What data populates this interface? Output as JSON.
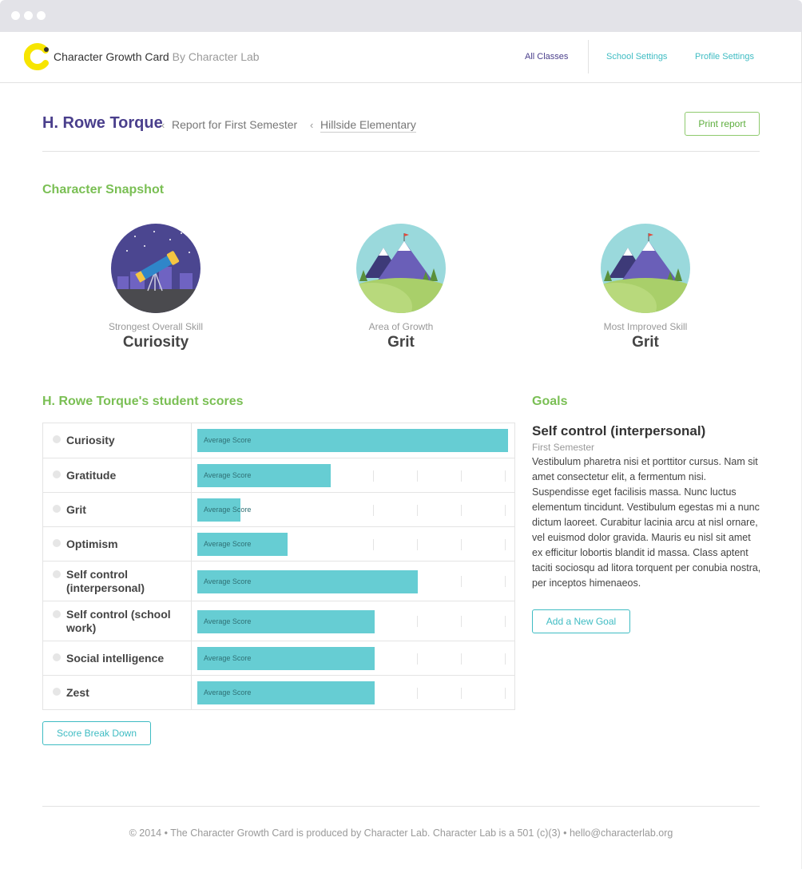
{
  "window": {
    "controls": [
      "dot",
      "dot",
      "dot"
    ]
  },
  "header": {
    "brand": "Character Growth Card",
    "brand_by": "By Character Lab",
    "nav": [
      {
        "label": "All Classes",
        "active": true
      },
      {
        "label": "School Settings",
        "active": false
      },
      {
        "label": "Profile Settings",
        "active": false
      }
    ]
  },
  "title": {
    "student": "H. Rowe Torque",
    "separator": "‹",
    "report": "Report for First Semester",
    "school": "Hillside Elementary",
    "print_label": "Print report"
  },
  "snapshot": {
    "heading": "Character Snapshot",
    "items": [
      {
        "label": "Strongest Overall Skill",
        "value": "Curiosity",
        "icon": "telescope-icon"
      },
      {
        "label": "Area of Growth",
        "value": "Grit",
        "icon": "mountain-icon"
      },
      {
        "label": "Most Improved Skill",
        "value": "Grit",
        "icon": "mountain-icon"
      }
    ]
  },
  "scores": {
    "heading": "H. Rowe Torque's student scores",
    "bar_label": "Average Score",
    "rows": [
      {
        "name": "Curiosity",
        "score": 1.0
      },
      {
        "name": "Gratitude",
        "score": 0.43
      },
      {
        "name": "Grit",
        "score": 0.14
      },
      {
        "name": "Optimism",
        "score": 0.29
      },
      {
        "name": "Self control (interpersonal)",
        "score": 0.71
      },
      {
        "name": "Self control (school work)",
        "score": 0.57
      },
      {
        "name": "Social intelligence",
        "score": 0.57
      },
      {
        "name": "Zest",
        "score": 0.57
      }
    ],
    "breakdown_label": "Score Break Down"
  },
  "goals": {
    "heading": "Goals",
    "title": "Self control (interpersonal)",
    "term": "First Semester",
    "text": "Vestibulum pharetra nisi et porttitor cursus. Nam sit amet consectetur elit, a fermentum nisi. Suspendisse eget facilisis massa. Nunc luctus elementum tincidunt. Vestibulum egestas mi a nunc dictum laoreet. Curabitur lacinia arcu at nisl ornare, vel euismod dolor gravida. Mauris eu nisl sit amet ex efficitur lobortis blandit id massa. Class aptent taciti sociosqu ad litora torquent per conubia nostra, per inceptos himenaeos.",
    "add_label": "Add a New Goal"
  },
  "footer": {
    "text": "© 2014 • The Character Growth Card is produced by Character Lab. Character Lab is a 501 (c)(3) • hello@characterlab.org"
  },
  "colors": {
    "brand_purple": "#4a3f8c",
    "accent_green": "#7abf54",
    "accent_teal": "#3fbcc3",
    "bar_fill": "#66cdd3",
    "logo_yellow": "#f7e500"
  }
}
